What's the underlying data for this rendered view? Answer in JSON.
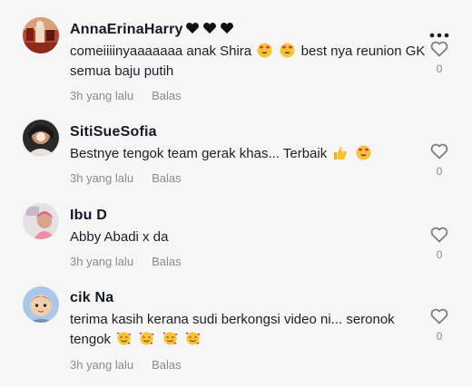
{
  "comments": [
    {
      "username": "AnnaErinaHarry",
      "username_suffix_icons": [
        "black-heart-icon",
        "black-heart-icon",
        "black-heart-icon"
      ],
      "text_parts": [
        "comeiiiinyaaaaaaa anak Shira",
        "best nya reunion GK semua baju putih"
      ],
      "emojis": [
        "heart-eyes-emoji",
        "heart-eyes-emoji"
      ],
      "time": "3h yang lalu",
      "reply": "Balas",
      "likes": "0"
    },
    {
      "username": "SitiSueSofia",
      "text_parts": [
        "Bestnye tengok team gerak khas... Terbaik"
      ],
      "emojis": [
        "thumbs-up-emoji",
        "heart-eyes-emoji"
      ],
      "time": "3h yang lalu",
      "reply": "Balas",
      "likes": "0"
    },
    {
      "username": "Ibu D",
      "text_parts": [
        "Abby Abadi x da"
      ],
      "time": "3h yang lalu",
      "reply": "Balas",
      "likes": "0"
    },
    {
      "username": "cik Na",
      "text_parts": [
        "terima kasih kerana sudi berkongsi video ni... seronok tengok"
      ],
      "emojis": [
        "smiling-face-hearts-emoji",
        "smiling-face-hearts-emoji",
        "smiling-face-hearts-emoji",
        "smiling-face-hearts-emoji"
      ],
      "time": "3h yang lalu",
      "reply": "Balas",
      "likes": "0"
    }
  ],
  "colors": {
    "background": "#f6f6f6",
    "text": "#161823",
    "muted": "#8a8b91",
    "icon": "#7a7b80"
  },
  "icons": {
    "more": "more-options-icon",
    "like": "heart-outline-icon"
  }
}
